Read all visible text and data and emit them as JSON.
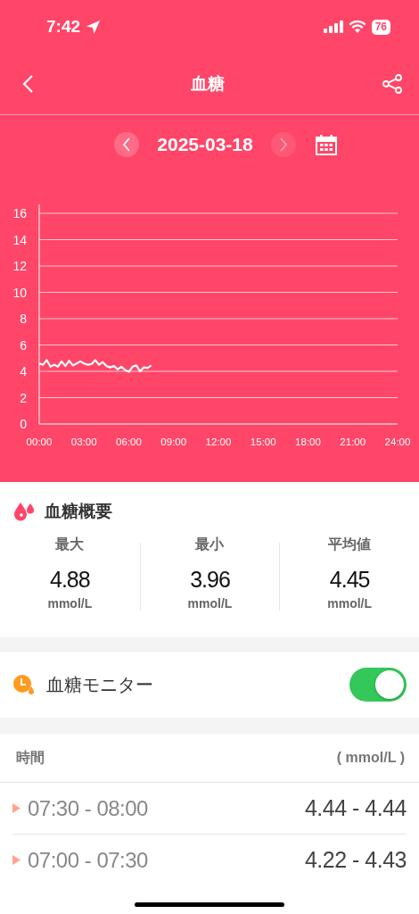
{
  "status_bar": {
    "time": "7:42",
    "battery": "76"
  },
  "header": {
    "title": "血糖"
  },
  "date_nav": {
    "date": "2025-03-18",
    "next_disabled": true
  },
  "chart": {
    "chart_data": {
      "type": "line",
      "x": [
        0,
        0.25,
        0.5,
        0.75,
        1,
        1.25,
        1.5,
        1.75,
        2,
        2.25,
        2.5,
        2.75,
        3,
        3.25,
        3.5,
        3.75,
        4,
        4.25,
        4.5,
        4.75,
        5,
        5.25,
        5.5,
        5.75,
        6,
        6.25,
        6.5,
        6.75,
        7,
        7.25,
        7.5
      ],
      "series": [
        {
          "color": "#ffffff",
          "values": [
            4.6,
            4.5,
            4.85,
            4.35,
            4.5,
            4.35,
            4.75,
            4.4,
            4.8,
            4.45,
            4.6,
            4.75,
            4.6,
            4.5,
            4.55,
            4.85,
            4.5,
            4.7,
            4.4,
            4.3,
            4.4,
            4.15,
            4.35,
            4.1,
            3.96,
            4.35,
            4.45,
            4.0,
            4.3,
            4.25,
            4.45
          ]
        }
      ],
      "xlim": [
        0,
        24
      ],
      "ylim": [
        0,
        16
      ],
      "xticks": [
        {
          "value": 0,
          "label": "00:00"
        },
        {
          "value": 3,
          "label": "03:00"
        },
        {
          "value": 6,
          "label": "06:00"
        },
        {
          "value": 9,
          "label": "09:00"
        },
        {
          "value": 12,
          "label": "12:00"
        },
        {
          "value": 15,
          "label": "15:00"
        },
        {
          "value": 18,
          "label": "18:00"
        },
        {
          "value": 21,
          "label": "21:00"
        },
        {
          "value": 24,
          "label": "24:00"
        }
      ],
      "yticks": [
        0,
        2,
        4,
        6,
        8,
        10,
        12,
        14,
        16
      ],
      "grid": true
    }
  },
  "summary": {
    "title": "血糖概要",
    "stats": [
      {
        "label": "最大",
        "value": "4.88",
        "unit": "mmol/L"
      },
      {
        "label": "最小",
        "value": "3.96",
        "unit": "mmol/L"
      },
      {
        "label": "平均値",
        "value": "4.45",
        "unit": "mmol/L"
      }
    ]
  },
  "monitor": {
    "label": "血糖モニター",
    "on": true
  },
  "readings": {
    "columns": [
      "時間",
      "( mmol/L )"
    ],
    "rows": [
      {
        "time": "07:30 - 08:00",
        "range": "4.44 - 4.44"
      },
      {
        "time": "07:00 - 07:30",
        "range": "4.22 - 4.43"
      }
    ]
  }
}
